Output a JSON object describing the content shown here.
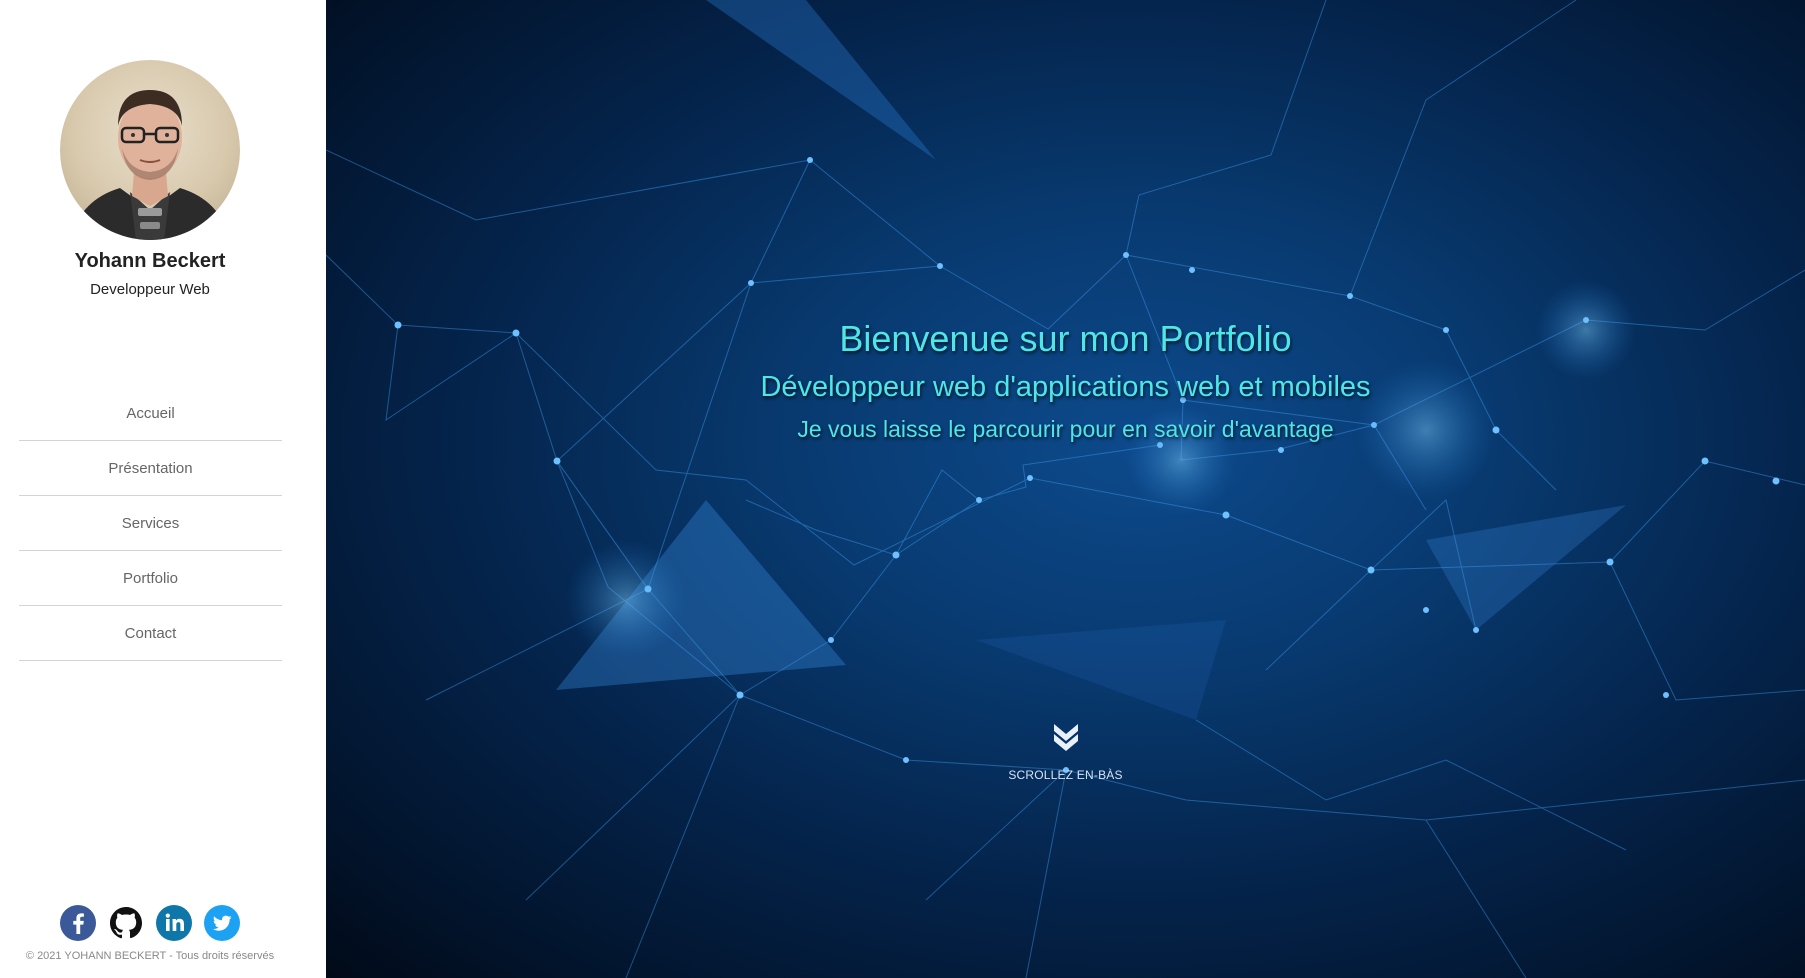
{
  "profile": {
    "name": "Yohann Beckert",
    "role": "Developpeur Web",
    "avatar_icon": "avatar-photo"
  },
  "nav": {
    "items": [
      {
        "label": "Accueil"
      },
      {
        "label": "Présentation"
      },
      {
        "label": "Services"
      },
      {
        "label": "Portfolio"
      },
      {
        "label": "Contact"
      }
    ]
  },
  "social": {
    "items": [
      {
        "name": "facebook-icon",
        "color": "#3b5998"
      },
      {
        "name": "github-icon",
        "color": "#111111"
      },
      {
        "name": "linkedin-icon",
        "color": "#0e76a8"
      },
      {
        "name": "twitter-icon",
        "color": "#1da1f2"
      }
    ]
  },
  "footer": {
    "copyright": "© 2021 YOHANN BECKERT - Tous droits réservés"
  },
  "hero": {
    "title": "Bienvenue sur mon Portfolio",
    "subtitle": "Développeur web d'applications web et mobiles",
    "tagline": "Je vous laisse le parcourir pour en savoir d'avantage",
    "scroll_label": "SCROLLEZ EN-BÀS",
    "scroll_icon": "double-chevron-down-icon",
    "text_color": "#4ee6e6"
  }
}
